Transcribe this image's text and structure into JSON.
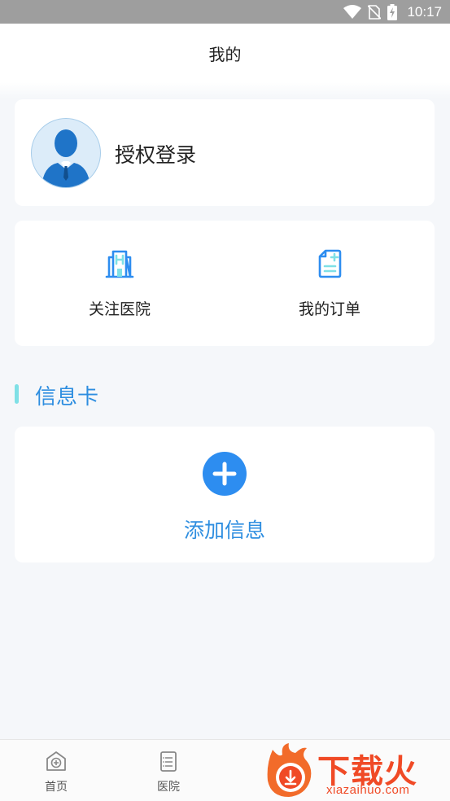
{
  "status_bar": {
    "time": "10:17"
  },
  "header": {
    "title": "我的"
  },
  "login": {
    "label": "授权登录"
  },
  "quick_actions": [
    {
      "label": "关注医院",
      "icon": "hospital-building-icon"
    },
    {
      "label": "我的订单",
      "icon": "order-document-icon"
    }
  ],
  "info_section": {
    "title": "信息卡",
    "add_label": "添加信息"
  },
  "tabbar": {
    "items": [
      {
        "label": "首页",
        "icon": "home-cross-icon"
      },
      {
        "label": "医院",
        "icon": "hospital-list-icon"
      }
    ]
  },
  "watermark": {
    "text": "下载火",
    "domain": "xiazaihuo.com"
  },
  "colors": {
    "accent": "#2d8df0",
    "section_bar": "#7fe0e6",
    "watermark": "#f04a26"
  }
}
